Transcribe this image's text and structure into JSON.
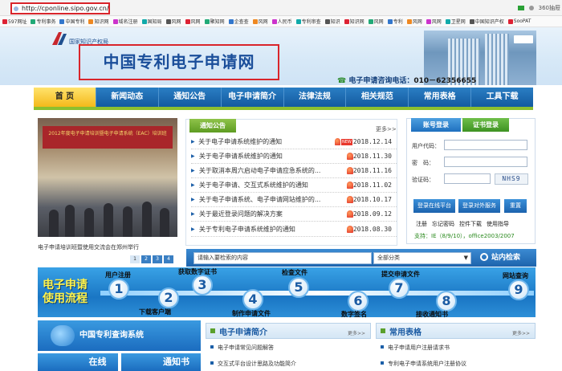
{
  "browser": {
    "url": "http://cponline.sipo.gov.cn/",
    "right_text": "360抽屉"
  },
  "bookmarks": [
    "597网址",
    "专利事务",
    "中国专利",
    "知识网",
    "域名注册",
    "国知局",
    "风网",
    "风网",
    "聚知网",
    "企查查",
    "风网",
    "人民币",
    "专利审查",
    "知识",
    "知识网",
    "风网",
    "专利",
    "风网",
    "风网",
    "卫星网",
    "中国知识产权",
    "SooPAT"
  ],
  "header": {
    "org": "国家知识产权局",
    "title": "中国专利电子申请网",
    "phone_label": "电子申请咨询电话：",
    "phone_number": "010－62356655"
  },
  "nav": [
    "首 页",
    "新闻动态",
    "通知公告",
    "电子申请简介",
    "法律法规",
    "相关规范",
    "常用表格",
    "工具下载"
  ],
  "photo": {
    "banner": "2012年度电子申请培训暨电子申请系统（EAC）培训班",
    "caption": "电子申请培训班暨使用交流会在郑州举行",
    "pages": [
      "1",
      "2",
      "3",
      "4"
    ]
  },
  "notice": {
    "tab": "通知公告",
    "more": "更多>>",
    "items": [
      {
        "text": "关于电子申请系统维护的通知",
        "new": "NEW",
        "date": "2018.12.14"
      },
      {
        "text": "关于电子申请系统维护的通知",
        "date": "2018.11.30"
      },
      {
        "text": "关于取消本周六启动电子申请应急系统的...",
        "date": "2018.11.16"
      },
      {
        "text": "关于电子申请、交互式系统维护的通知",
        "date": "2018.11.02"
      },
      {
        "text": "关于电子申请系统、电子申请网站维护的...",
        "date": "2018.10.17"
      },
      {
        "text": "关于最近登录问题的解决方案",
        "date": "2018.09.12"
      },
      {
        "text": "关于专利电子申请系统维护的通知",
        "date": "2018.08.30"
      }
    ]
  },
  "login": {
    "tab_account": "账号登录",
    "tab_cert": "证书登录",
    "user_label": "用户代码：",
    "pass_label": "密　码：",
    "captcha_label": "验证码：",
    "captcha": "NHS9",
    "btn_online": "登录在线平台",
    "btn_service": "登录对外服务",
    "btn_reset": "重置",
    "links": [
      "注册",
      "忘记密码",
      "控件下载",
      "使用指导"
    ],
    "support": "支持：IE（8/9/10），office2003/2007"
  },
  "search": {
    "placeholder": "请输入要检索的内容",
    "category": "全部分类",
    "button": "站内检索"
  },
  "flow": {
    "title_line1": "电子申请",
    "title_line2": "使用流程",
    "steps": [
      "1",
      "2",
      "3",
      "4",
      "5",
      "6",
      "7",
      "8",
      "9"
    ],
    "labels_top": [
      "用户注册",
      "获取数字证书",
      "检查文件",
      "提交申请文件",
      "网站查询"
    ],
    "labels_bottom": [
      "下载客户端",
      "制作申请文件",
      "数字签名",
      "接收通知书"
    ]
  },
  "query_system": "中国专利查询系统",
  "bottom_buttons": [
    "在线",
    "通知书"
  ],
  "intro": {
    "title": "电子申请简介",
    "more": "更多>>",
    "items": [
      "电子申请常见问题解答",
      "交互式平台设计思路及功能简介"
    ]
  },
  "forms": {
    "title": "常用表格",
    "more": "更多>>",
    "items": [
      "电子申请用户注册请求书",
      "专利电子申请系统用户注册协议"
    ]
  }
}
